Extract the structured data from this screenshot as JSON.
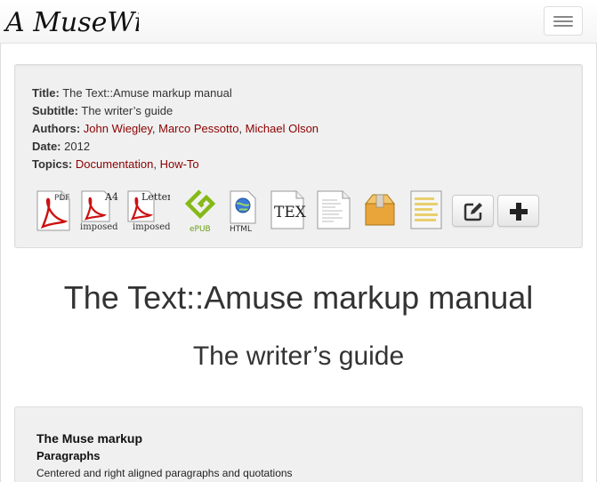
{
  "brand": {
    "logo_text": "A MuseWiki"
  },
  "navbar": {
    "toggle_label": ""
  },
  "metadata": {
    "title_label": "Title:",
    "title_value": "The Text::Amuse markup manual",
    "subtitle_label": "Subtitle:",
    "subtitle_value": "The writer’s guide",
    "authors_label": "Authors:",
    "authors": [
      "John Wiegley",
      "Marco Pessotto",
      "Michael Olson"
    ],
    "date_label": "Date:",
    "date_value": "2012",
    "topics_label": "Topics:",
    "topics": [
      "Documentation",
      "How-To"
    ],
    "separator": ", "
  },
  "downloads": {
    "pdf": "PDF",
    "a4": "A4",
    "a4_sub": "imposed",
    "letter": "Letter",
    "letter_sub": "imposed",
    "epub": "ePUB",
    "html": "HTML",
    "tex": "TEX"
  },
  "heading": {
    "title": "The Text::Amuse markup manual",
    "subtitle": "The writer’s guide"
  },
  "toc": {
    "section": "The Muse markup",
    "subsection": "Paragraphs",
    "item": "Centered and right aligned paragraphs and quotations"
  },
  "colors": {
    "link": "#8b0000",
    "well": "#f0f0f0",
    "pdf_red": "#cc1111",
    "epub_green": "#85b918"
  }
}
